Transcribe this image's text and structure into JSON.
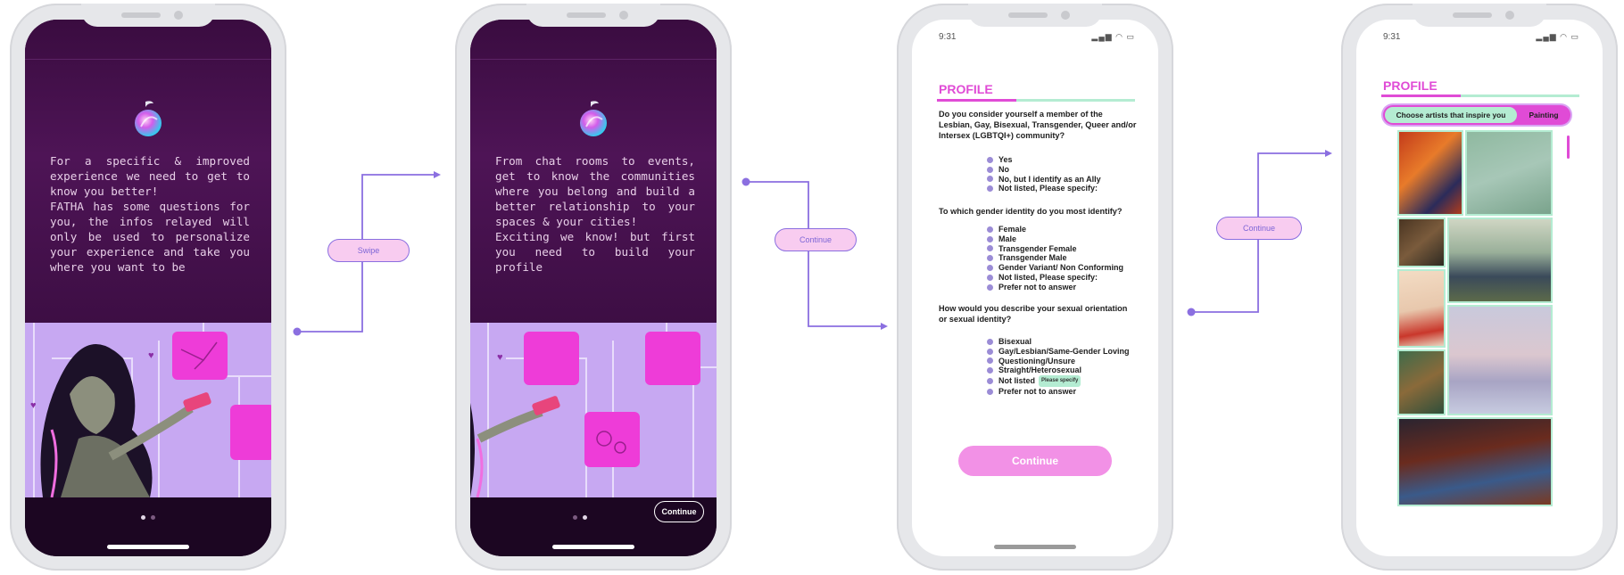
{
  "screens": {
    "onboarding1": {
      "text": "For a specific & improved experience we need to get to know you better!\nFATHA has some questions for you, the infos relayed will only be used to personalize your experience and take you where you want to be"
    },
    "onboarding2": {
      "text": "From chat rooms to events, get to know the communities where you belong and build a better relationship to your spaces & your cities!\nExciting we know! but first you need to build your profile",
      "continue_label": "Continue"
    },
    "profile_questions": {
      "time": "9:31",
      "status_icons": "▂▄▆ ◠ ▭",
      "title": "PROFILE",
      "q1": "Do you consider yourself a member of the Lesbian, Gay, Bisexual, Transgender, Queer and/or Intersex (LGBTQI+) community?",
      "q1_options": [
        "Yes",
        "No",
        "No, but I identify as an Ally",
        "Not listed, Please specify:"
      ],
      "q2": "To which gender identity do you most identify?",
      "q2_options": [
        "Female",
        "Male",
        "Transgender Female",
        "Transgender Male",
        "Gender Variant/ Non Conforming",
        "Not listed, Please specify:",
        "Prefer not to answer"
      ],
      "q3": "How would you describe your sexual orientation or sexual identity?",
      "q3_options": [
        "Bisexual",
        "Gay/Lesbian/Same-Gender Loving",
        "Questioning/Unsure",
        "Straight/Heterosexual",
        "Not listed",
        "Prefer not to answer"
      ],
      "q3_specify_tag": "Please specify",
      "continue_label": "Continue"
    },
    "profile_artists": {
      "time": "9:31",
      "status_icons": "▂▄▆ ◠ ▭",
      "title": "PROFILE",
      "segment_left": "Choose artists that inspire you",
      "segment_right": "Painting"
    }
  },
  "flow_labels": {
    "swipe": "Swipe",
    "continue_1": "Continue",
    "continue_2": "Continue"
  },
  "colors": {
    "accent_pink": "#e04bd6",
    "mint": "#b4ecd2",
    "connector": "#8b6fe0",
    "dark_bg": "#3a0c40"
  }
}
